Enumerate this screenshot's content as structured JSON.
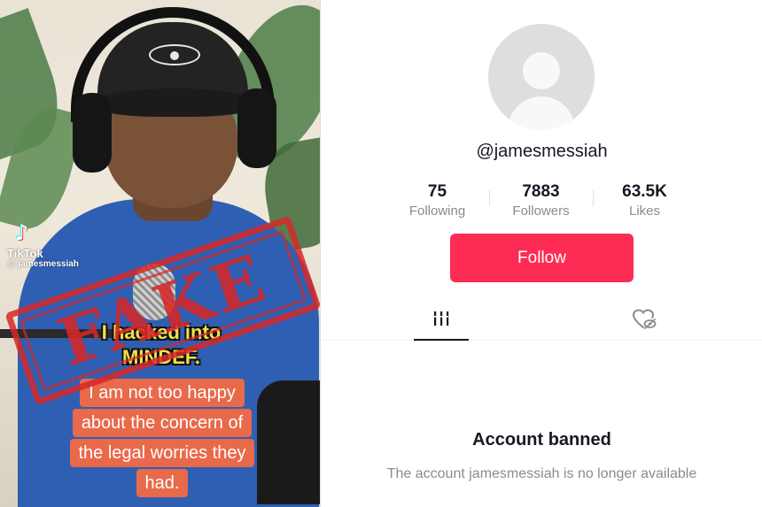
{
  "video": {
    "app_brand": "TikTok",
    "watermark_handle": "@ jamesmessiah",
    "caption_top_line1": "I hacked into",
    "caption_top_line2": "MINDEF.",
    "caption_lines": [
      "I am not too happy",
      "about the concern of",
      "the legal worries they",
      "had."
    ],
    "stamp_text": "FAKE"
  },
  "profile": {
    "username": "@jamesmessiah",
    "stats": [
      {
        "value": "75",
        "label": "Following"
      },
      {
        "value": "7883",
        "label": "Followers"
      },
      {
        "value": "63.5K",
        "label": "Likes"
      }
    ],
    "follow_label": "Follow",
    "tabs": [
      {
        "icon": "grid-icon"
      },
      {
        "icon": "liked-hidden-icon"
      }
    ],
    "banned_title": "Account banned",
    "banned_desc": "The account jamesmessiah is no longer available"
  },
  "colors": {
    "follow_button": "#fe2c55",
    "stamp": "#d62828",
    "caption_bg": "#e9694b",
    "caption_yellow": "#f4e04a"
  }
}
